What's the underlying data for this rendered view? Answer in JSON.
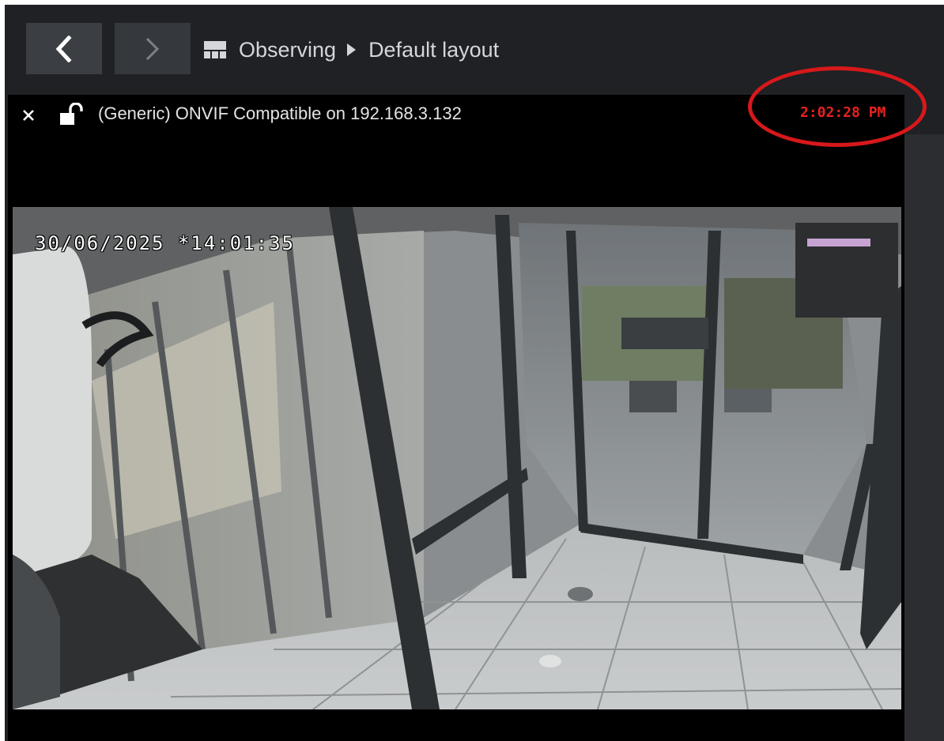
{
  "nav": {
    "back_icon": "chevron-left-icon",
    "forward_icon": "chevron-right-icon",
    "layout_icon": "grid-layout-icon",
    "breadcrumb": [
      "Observing",
      "Default layout"
    ],
    "separator_icon": "caret-right-icon"
  },
  "tile": {
    "close_icon": "close-icon",
    "lock_icon": "unlock-icon",
    "camera_name": "(Generic) ONVIF Compatible on 192.168.3.132",
    "clock": "2:02:28 PM",
    "clock_color": "#e8221f",
    "annotation_color": "#d7181b"
  },
  "video": {
    "osd_timestamp": "30/06/2025 *14:01:35"
  }
}
